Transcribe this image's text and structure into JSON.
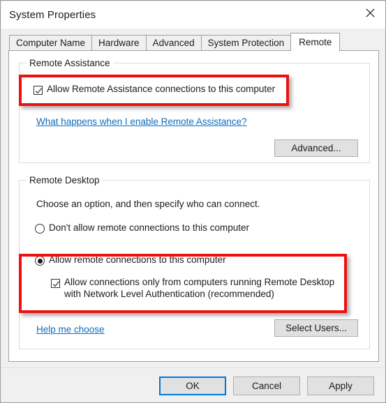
{
  "window": {
    "title": "System Properties",
    "close_icon": "close-icon"
  },
  "tabs": [
    {
      "label": "Computer Name",
      "active": false
    },
    {
      "label": "Hardware",
      "active": false
    },
    {
      "label": "Advanced",
      "active": false
    },
    {
      "label": "System Protection",
      "active": false
    },
    {
      "label": "Remote",
      "active": true
    }
  ],
  "remote_assistance": {
    "group_title": "Remote Assistance",
    "allow_checkbox": {
      "label": "Allow Remote Assistance connections to this computer",
      "checked": true
    },
    "help_link": "What happens when I enable Remote Assistance?",
    "advanced_button": "Advanced..."
  },
  "remote_desktop": {
    "group_title": "Remote Desktop",
    "instruction": "Choose an option, and then specify who can connect.",
    "options": [
      {
        "label": "Don't allow remote connections to this computer",
        "selected": false
      },
      {
        "label": "Allow remote connections to this computer",
        "selected": true
      }
    ],
    "nla_checkbox": {
      "line1": "Allow connections only from computers running Remote Desktop",
      "line2": "with Network Level Authentication (recommended)",
      "checked": true
    },
    "help_link": "Help me choose",
    "select_users_button": "Select Users..."
  },
  "footer": {
    "ok": "OK",
    "cancel": "Cancel",
    "apply": "Apply"
  },
  "annotations": {
    "color": "#ee1111",
    "boxes": [
      "remote-assistance-allow-checkbox",
      "remote-desktop-allow-connections-option"
    ]
  },
  "colors": {
    "link": "#0f6cbd",
    "default_button_focus": "#0078d7",
    "dialog_background": "#f0f0f0",
    "panel_background": "#ffffff"
  }
}
